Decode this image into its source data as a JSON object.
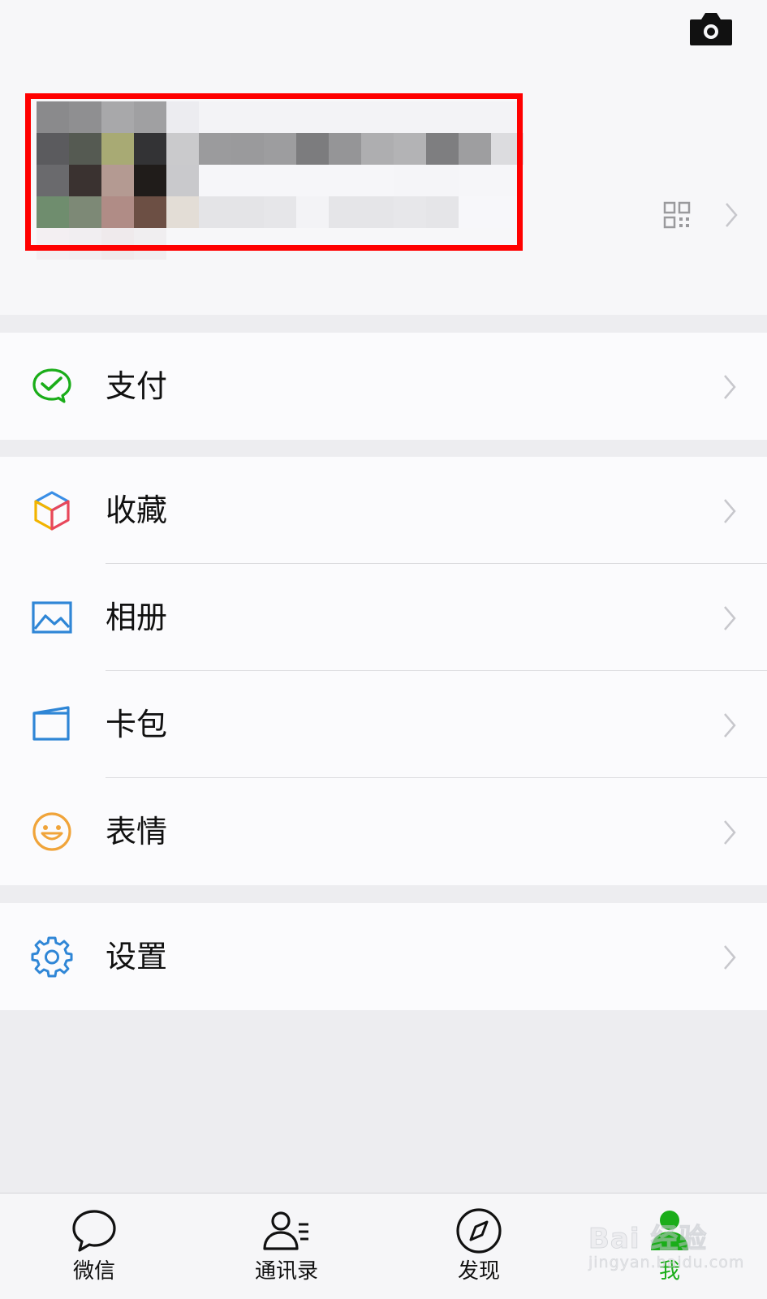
{
  "profile": {
    "avatar_pixels": [
      "#8a8a8c",
      "#8f8f91",
      "#a8a8aa",
      "#a0a0a2",
      "#ececf0",
      "#f3f3f6",
      "#f3f3f6",
      "#f3f3f6",
      "#f3f3f6",
      "#f3f3f6",
      "#f3f3f6",
      "#f3f3f6",
      "#f3f3f6",
      "#f3f3f6",
      "#f3f3f6",
      "#5b5b5e",
      "#555a52",
      "#a8aa74",
      "#333335",
      "#cacacc",
      "#9b9b9d",
      "#9a9a9c",
      "#9d9d9f",
      "#7c7c7e",
      "#959597",
      "#aeaeb0",
      "#b3b3b5",
      "#7e7e80",
      "#9e9ea0",
      "#dcdcdf",
      "#6a6a6d",
      "#3a3230",
      "#b49a92",
      "#201c1a",
      "#c9c9cc",
      "#f6f6f9",
      "#f6f6f9",
      "#f6f6f9",
      "#f6f6f9",
      "#f6f6f9",
      "#f6f6f9",
      "#f5f5f8",
      "#f5f5f8",
      "#f6f6f9",
      "#f6f6f9",
      "#6f8d6e",
      "#7d8976",
      "#b08c86",
      "#6c4f44",
      "#e3ddd6",
      "#e4e4e7",
      "#e4e4e7",
      "#e6e6e9",
      "#f3f3f6",
      "#e5e5e8",
      "#e5e5e8",
      "#e7e7ea",
      "#e5e5e8",
      "#f7f7fa",
      "#f7f7fa",
      "#f3eff2",
      "#f1eef1",
      "#efeaec",
      "#f0eef0",
      "#f7f7f9",
      "#f7f7f9",
      "#f7f7f9",
      "#f7f7f9",
      "#f7f7f9",
      "#f7f7f9",
      "#f7f7f9",
      "#f7f7f9",
      "#f7f7f9",
      "#f7f7f9",
      "#f7f7f9"
    ],
    "highlight_color": "#ff0000"
  },
  "icons": {
    "camera": "camera-icon",
    "qr": "qr-code-icon",
    "chevron": "chevron-right-icon"
  },
  "menu": {
    "pay": {
      "label": "支付",
      "icon": "wechat-pay-icon",
      "color": "#1aad19"
    },
    "favorites": {
      "label": "收藏",
      "icon": "cube-icon",
      "color": "#3a8ee6"
    },
    "album": {
      "label": "相册",
      "icon": "picture-icon",
      "color": "#2f86d6"
    },
    "cards": {
      "label": "卡包",
      "icon": "card-wallet-icon",
      "color": "#2f86d6"
    },
    "stickers": {
      "label": "表情",
      "icon": "smiley-icon",
      "color": "#f0a43a"
    },
    "settings": {
      "label": "设置",
      "icon": "gear-icon",
      "color": "#2f86d6"
    }
  },
  "tabs": [
    {
      "label": "微信",
      "icon": "chat-bubble-icon",
      "active": false
    },
    {
      "label": "通讯录",
      "icon": "contacts-icon",
      "active": false
    },
    {
      "label": "发现",
      "icon": "compass-icon",
      "active": false
    },
    {
      "label": "我",
      "icon": "person-icon",
      "active": true
    }
  ],
  "colors": {
    "accent": "#1aad19",
    "background": "#ededf0",
    "row_background": "#fbfbfd"
  },
  "watermark": {
    "brand": "Bai 经验",
    "sub": "jingyan.baidu.com"
  }
}
